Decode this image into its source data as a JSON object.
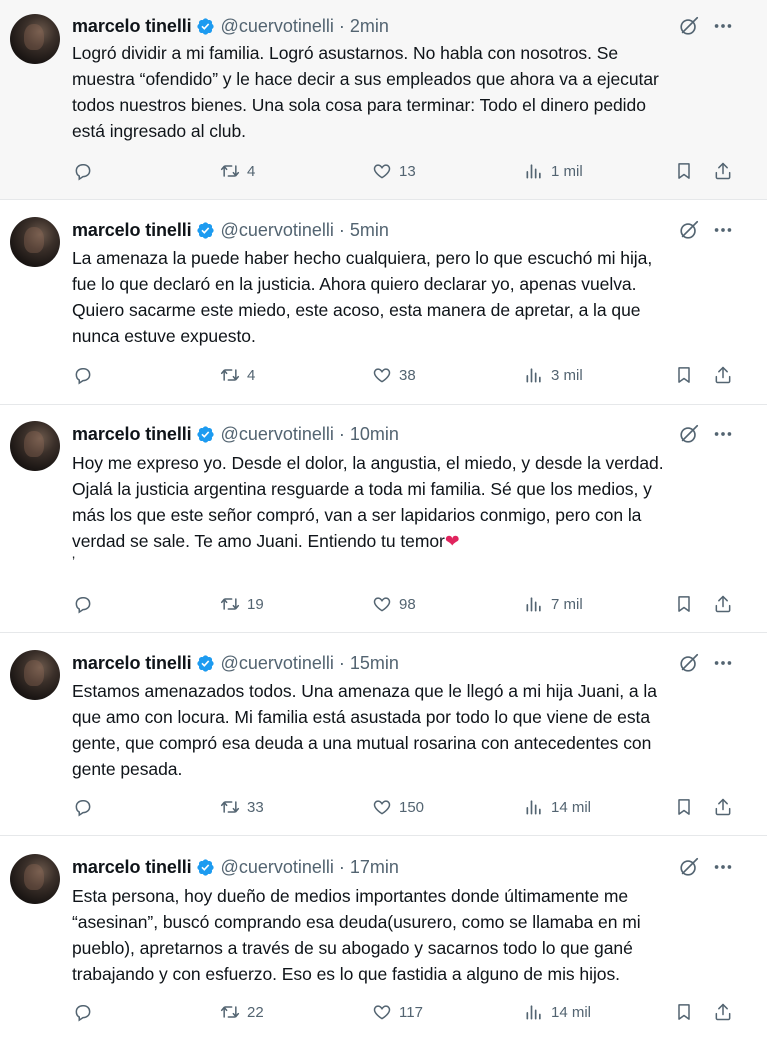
{
  "author": {
    "name": "marcelo tinelli",
    "handle": "@cuervotinelli",
    "separator": "·"
  },
  "icons": {
    "verified": "verified-badge-icon",
    "grok": "grok-icon",
    "more": "more-options-icon",
    "reply": "reply-icon",
    "retweet": "retweet-icon",
    "like": "heart-icon",
    "views": "views-icon",
    "bookmark": "bookmark-icon",
    "share": "share-icon"
  },
  "colors": {
    "verified": "#1d9bf0",
    "secondary_text": "#536471",
    "heart_emoji": "#e0245e"
  },
  "tweets": [
    {
      "time": "2min",
      "lines": [
        "Logró dividir a mi familia. Logró asustarnos. No habla con nosotros. Se",
        "muestra “ofendido” y le hace decir a sus empleados que ahora va a ejecutar",
        "todos nuestros bienes. Una sola cosa para terminar: Todo el dinero pedido",
        "está ingresado al club."
      ],
      "retweets": "4",
      "likes": "13",
      "views": "1 mil"
    },
    {
      "time": "5min",
      "lines": [
        "La amenaza la puede haber hecho cualquiera, pero lo que  escuchó mi hija,",
        "fue lo que declaró en la justicia. Ahora quiero declarar yo, apenas vuelva.",
        "Quiero sacarme este miedo, este acoso, esta manera de apretar, a la que",
        "nunca estuve expuesto."
      ],
      "retweets": "4",
      "likes": "38",
      "views": "3 mil"
    },
    {
      "time": "10min",
      "lines": [
        "Hoy me expreso yo. Desde el dolor, la angustia, el miedo, y desde la verdad.",
        "Ojalá la justicia argentina resguarde a toda mi familia. Sé que los medios, y",
        "más los que este señor compró, van a ser lapidarios conmigo, pero con la",
        "verdad se sale. Te amo Juani. Entiendo tu temor",
        "’"
      ],
      "emoji": "❤",
      "retweets": "19",
      "likes": "98",
      "views": "7 mil"
    },
    {
      "time": "15min",
      "lines": [
        "Estamos amenazados todos. Una amenaza que le llegó a mi hija Juani, a la",
        "que amo con locura. Mi familia está asustada por todo lo que viene de esta",
        "gente, que compró esa deuda a una mutual rosarina con antecedentes con",
        "gente pesada."
      ],
      "retweets": "33",
      "likes": "150",
      "views": "14 mil"
    },
    {
      "time": "17min",
      "lines": [
        "Esta persona, hoy dueño de medios importantes donde últimamente me",
        "“asesinan”, buscó comprando esa deuda(usurero, como se llamaba en mi",
        "pueblo), apretarnos a través de su abogado y sacarnos todo lo que gané",
        "trabajando y con esfuerzo. Eso es lo que fastidia a alguno de mis hijos."
      ],
      "retweets": "22",
      "likes": "117",
      "views": "14 mil"
    }
  ]
}
